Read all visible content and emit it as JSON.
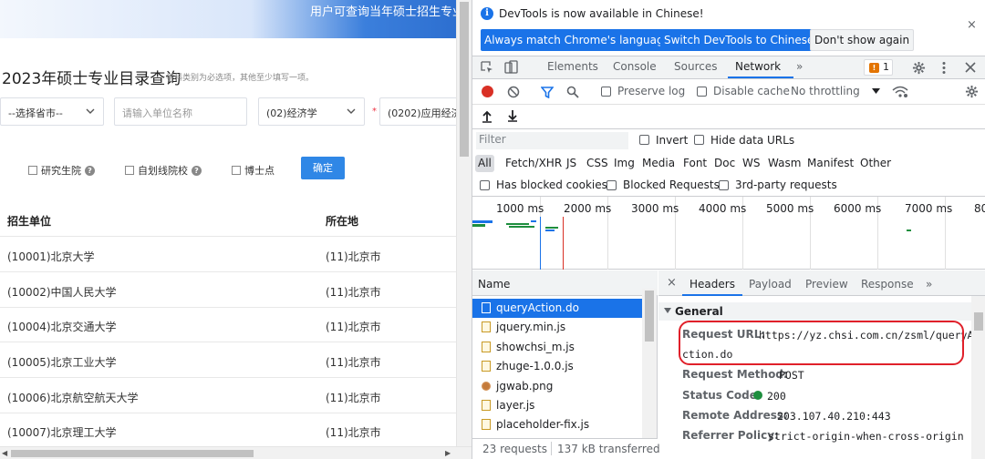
{
  "page": {
    "banner_text": "用户可查询当年硕士招生专业",
    "title": "2023年硕士专业目录查询",
    "hint": "学科类别为必选项，其他至少填写一项。",
    "province_select": "--选择省市--",
    "unit_input_placeholder": "请输入单位名称",
    "category_select": "(02)经济学",
    "required_mark": "*",
    "discipline_select": "(0202)应用经济",
    "checkboxes": [
      "研究生院",
      "自划线院校",
      "博士点"
    ],
    "confirm_button": "确定",
    "table": {
      "headers": [
        "招生单位",
        "所在地"
      ],
      "rows": [
        [
          "(10001)北京大学",
          "(11)北京市"
        ],
        [
          "(10002)中国人民大学",
          "(11)北京市"
        ],
        [
          "(10004)北京交通大学",
          "(11)北京市"
        ],
        [
          "(10005)北京工业大学",
          "(11)北京市"
        ],
        [
          "(10006)北京航空航天大学",
          "(11)北京市"
        ],
        [
          "(10007)北京理工大学",
          "(11)北京市"
        ]
      ]
    }
  },
  "devtools": {
    "infobar": {
      "message": "DevTools is now available in Chinese!",
      "btn_match": "Always match Chrome's language",
      "btn_switch": "Switch DevTools to Chinese",
      "btn_dismiss": "Don't show again",
      "close": "×"
    },
    "tabs": [
      "Elements",
      "Console",
      "Sources",
      "Network"
    ],
    "more_tabs": "»",
    "issues_count": "1",
    "toolbar": {
      "preserve_log": "Preserve log",
      "disable_cache": "Disable cache",
      "throttling": "No throttling"
    },
    "filter": {
      "placeholder": "Filter",
      "invert": "Invert",
      "hide_data_urls": "Hide data URLs"
    },
    "types": [
      "All",
      "Fetch/XHR",
      "JS",
      "CSS",
      "Img",
      "Media",
      "Font",
      "Doc",
      "WS",
      "Wasm",
      "Manifest",
      "Other"
    ],
    "blocking": {
      "has_blocked_cookies": "Has blocked cookies",
      "blocked_requests": "Blocked Requests",
      "third_party": "3rd-party requests"
    },
    "timeline_ticks": [
      "1000 ms",
      "2000 ms",
      "3000 ms",
      "4000 ms",
      "5000 ms",
      "6000 ms",
      "7000 ms",
      "80"
    ],
    "request_list": {
      "column": "Name",
      "items": [
        "queryAction.do",
        "jquery.min.js",
        "showchsi_m.js",
        "zhuge-1.0.0.js",
        "jgwab.png",
        "layer.js",
        "placeholder-fix.js"
      ],
      "selected": "queryAction.do",
      "status_requests": "23 requests",
      "status_transferred": "137 kB transferred"
    },
    "detail_tabs": [
      "Headers",
      "Payload",
      "Preview",
      "Response"
    ],
    "detail_close": "×",
    "general": {
      "section": "General",
      "request_url_label": "Request URL:",
      "request_url_line1": "https://yz.chsi.com.cn/zsml/queryA",
      "request_url_line2": "ction.do",
      "request_method_label": "Request Method:",
      "request_method": "POST",
      "status_code_label": "Status Code:",
      "status_code": "200",
      "remote_address_label": "Remote Address:",
      "remote_address": "203.107.40.210:443",
      "referrer_policy_label": "Referrer Policy:",
      "referrer_policy": "strict-origin-when-cross-origin"
    },
    "colors": {
      "accent": "#1a73e8",
      "highlight_oval": "#e0202a",
      "status_ok": "#1e8e3e",
      "record_red": "#d93025"
    }
  }
}
